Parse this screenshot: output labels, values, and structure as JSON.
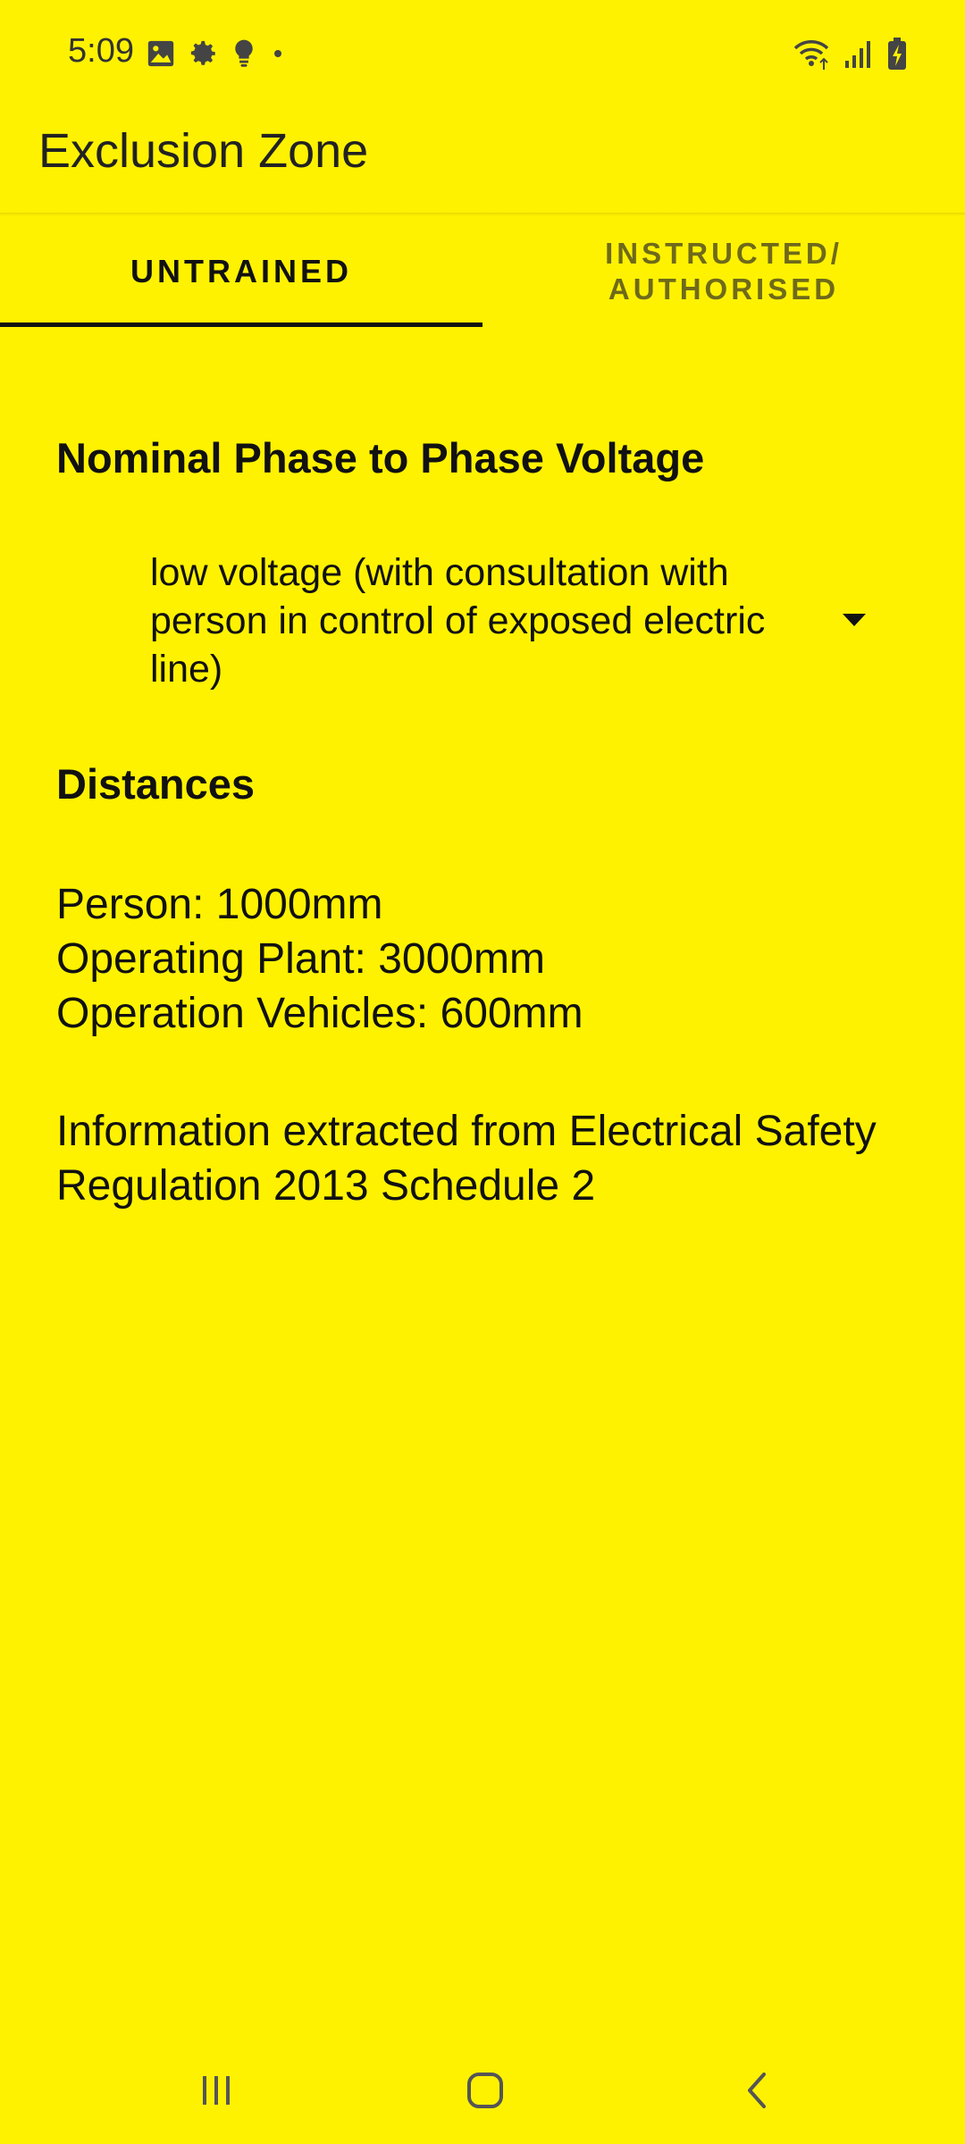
{
  "status_bar": {
    "time": "5:09",
    "left_icons": [
      "image-icon",
      "gear-icon",
      "lightbulb-icon",
      "dot-icon"
    ],
    "right_icons": [
      "wifi-icon",
      "signal-icon",
      "battery-charging-icon"
    ]
  },
  "app_bar": {
    "title": "Exclusion Zone"
  },
  "tabs": [
    {
      "label": "UNTRAINED",
      "selected": true
    },
    {
      "label": "INSTRUCTED/ AUTHORISED",
      "selected": false
    }
  ],
  "voltage": {
    "title": "Nominal Phase to Phase Voltage",
    "selected_value": "low voltage (with consultation with person in control of exposed electric line)"
  },
  "distances": {
    "title": "Distances",
    "lines": [
      "Person: 1000mm",
      "Operating Plant: 3000mm",
      "Operation Vehicles: 600mm"
    ]
  },
  "info_text": "Information extracted from Electrical Safety Regulation 2013 Schedule 2",
  "nav_bar": {
    "buttons": [
      "recent-apps-icon",
      "home-icon",
      "back-icon"
    ]
  },
  "colors": {
    "background": "#FFF200",
    "text": "#111111",
    "inactive_tab": "#6F6A1A"
  }
}
